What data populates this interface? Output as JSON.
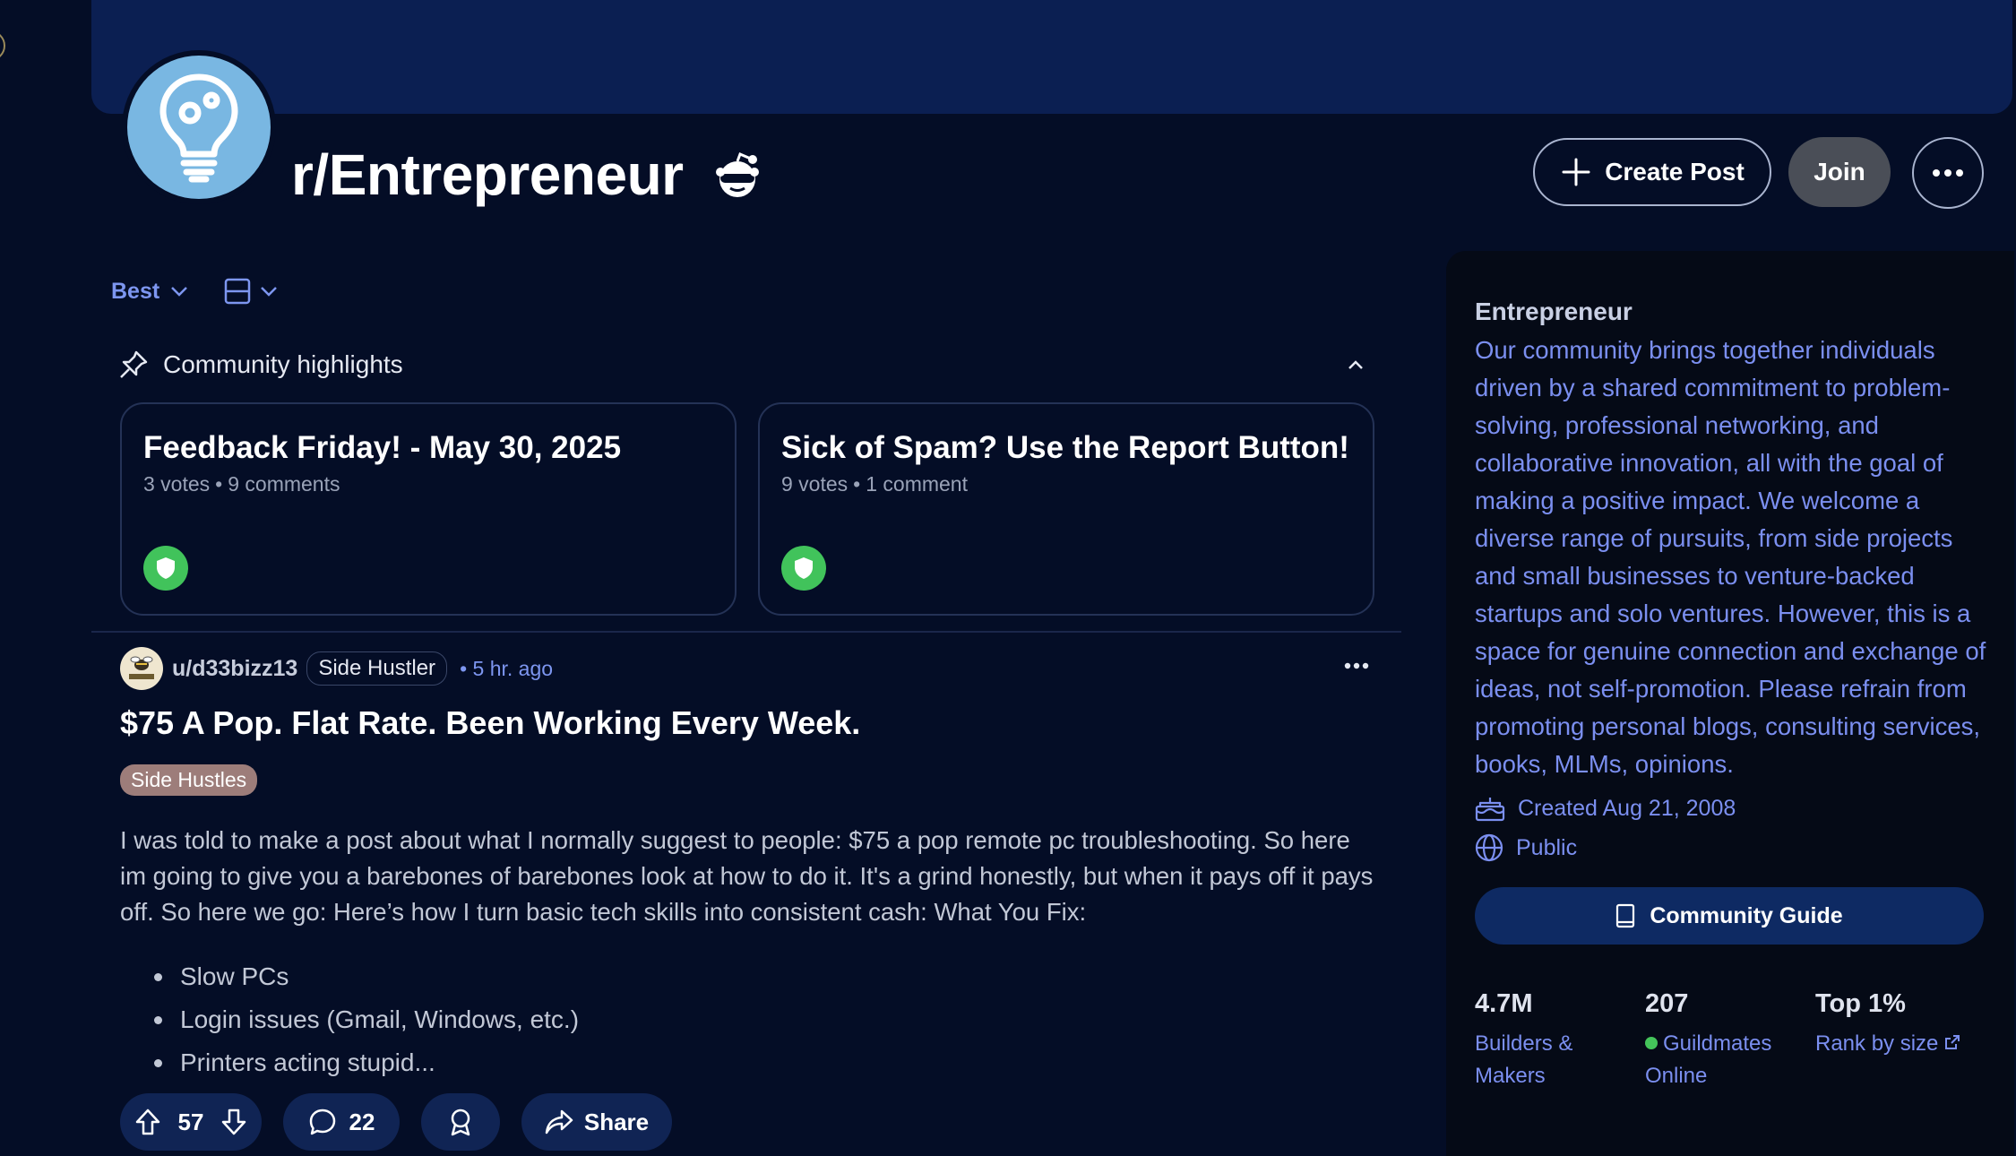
{
  "header": {
    "subreddit_name": "r/Entrepreneur",
    "create_post_label": "Create Post",
    "join_label": "Join"
  },
  "feed": {
    "sort_label": "Best"
  },
  "highlights": {
    "header_label": "Community highlights",
    "cards": [
      {
        "title": "Feedback Friday! - May 30, 2025",
        "votes": "3 votes",
        "comments": "9 comments"
      },
      {
        "title": "Sick of Spam? Use the Report Button!",
        "votes": "9 votes",
        "comments": "1 comment"
      }
    ]
  },
  "post": {
    "username": "u/d33bizz13",
    "user_flair": "Side Hustler",
    "time": "5 hr. ago",
    "title": "$75 A Pop. Flat Rate. Been Working Every Week.",
    "flair": "Side Hustles",
    "body": "I was told to make a post about what I normally suggest to people: $75 a pop remote pc troubleshooting. So here im going to give you a barebones of barebones look at how to do it. It's a grind honestly, but when it pays off it pays off. So here we go: Here’s how I turn basic tech skills into consistent cash: What You Fix:",
    "list": [
      "Slow PCs",
      "Login issues (Gmail, Windows, etc.)",
      "Printers acting stupid..."
    ],
    "upvotes": "57",
    "comments": "22",
    "share_label": "Share"
  },
  "sidebar": {
    "name": "Entrepreneur",
    "description": "Our community brings together individuals driven by a shared commitment to problem-solving, professional networking, and collaborative innovation, all with the goal of making a positive impact. We welcome a diverse range of pursuits, from side projects and small businesses to venture-backed startups and solo ventures. However, this is a space for genuine connection and exchange of ideas, not self-promotion. Please refrain from promoting personal blogs, consulting services, books, MLMs, opinions.",
    "created": "Created Aug 21, 2008",
    "visibility": "Public",
    "guide_label": "Community Guide",
    "stats": [
      {
        "value": "4.7M",
        "label": "Builders & Makers"
      },
      {
        "value": "207",
        "label": "Guildmates Online"
      },
      {
        "value": "Top 1%",
        "label": "Rank by size"
      }
    ]
  },
  "colors": {
    "background": "#040d26",
    "banner": "#0b1f52",
    "accent_link": "#7b8ff0",
    "mod_green": "#41c35b",
    "join_bg": "#4a4e57",
    "flair_bg": "#9d7d7a"
  },
  "icons": [
    "lightbulb-gear-icon",
    "snoo-sunglasses-icon",
    "plus-icon",
    "ellipsis-icon",
    "chevron-down-icon",
    "card-view-icon",
    "pin-icon",
    "chevron-up-icon",
    "shield-icon",
    "upvote-icon",
    "downvote-icon",
    "comment-icon",
    "award-icon",
    "share-icon",
    "cake-icon",
    "globe-icon",
    "book-icon",
    "external-link-icon"
  ]
}
